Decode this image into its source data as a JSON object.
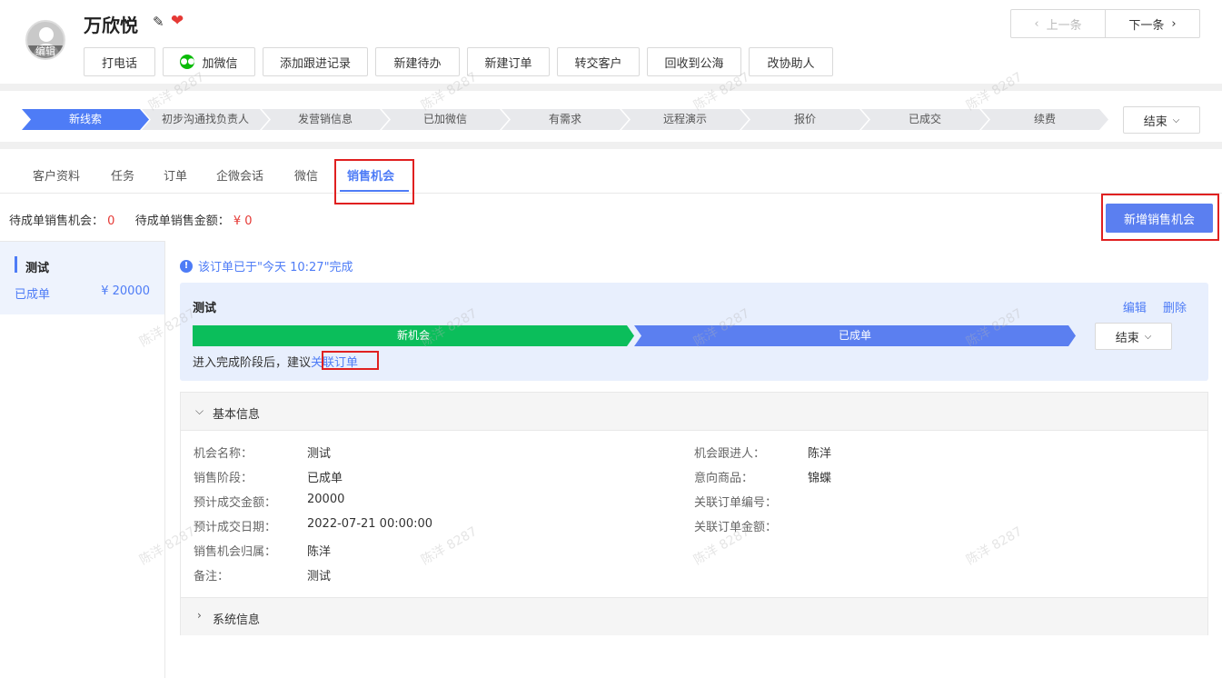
{
  "customer": {
    "name": "万欣悦",
    "avatar_edit_label": "编辑"
  },
  "actions": [
    "打电话",
    "加微信",
    "添加跟进记录",
    "新建待办",
    "新建订单",
    "转交客户",
    "回收到公海",
    "改协助人"
  ],
  "pager": {
    "prev": "上一条",
    "next": "下一条"
  },
  "stages": [
    "新线索",
    "初步沟通找负责人",
    "发营销信息",
    "已加微信",
    "有需求",
    "远程演示",
    "报价",
    "已成交",
    "续费"
  ],
  "stage_end_label": "结束",
  "tabs": [
    "客户资料",
    "任务",
    "订单",
    "企微会话",
    "微信",
    "销售机会"
  ],
  "active_tab": "销售机会",
  "summary": {
    "pending_count_label": "待成单销售机会：",
    "pending_count": "0",
    "pending_amount_label": "待成单销售金额：",
    "pending_amount": "¥ 0"
  },
  "add_button": "新增销售机会",
  "opportunity_list": [
    {
      "title": "测试",
      "stage": "已成单",
      "amount": "¥ 20000"
    }
  ],
  "notice": "该订单已于\"今天 10:27\"完成",
  "opportunity": {
    "title": "测试",
    "edit": "编辑",
    "delete": "删除",
    "stages": [
      "新机会",
      "已成单"
    ],
    "end_label": "结束",
    "hint_prefix": "进入完成阶段后，建议",
    "hint_link": "关联订单"
  },
  "basic_info": {
    "header": "基本信息",
    "left": [
      {
        "label": "机会名称：",
        "value": "测试"
      },
      {
        "label": "销售阶段：",
        "value": "已成单"
      },
      {
        "label": "预计成交金额：",
        "value": "20000"
      },
      {
        "label": "预计成交日期：",
        "value": "2022-07-21 00:00:00"
      },
      {
        "label": "销售机会归属：",
        "value": "陈洋"
      },
      {
        "label": "备注：",
        "value": "测试"
      }
    ],
    "right": [
      {
        "label": "机会跟进人：",
        "value": "陈洋"
      },
      {
        "label": "意向商品：",
        "value": "锦蝶"
      },
      {
        "label": "关联订单编号：",
        "value": ""
      },
      {
        "label": "关联订单金额：",
        "value": ""
      }
    ]
  },
  "system_info_header": "系统信息",
  "watermark": "陈洋 8287"
}
